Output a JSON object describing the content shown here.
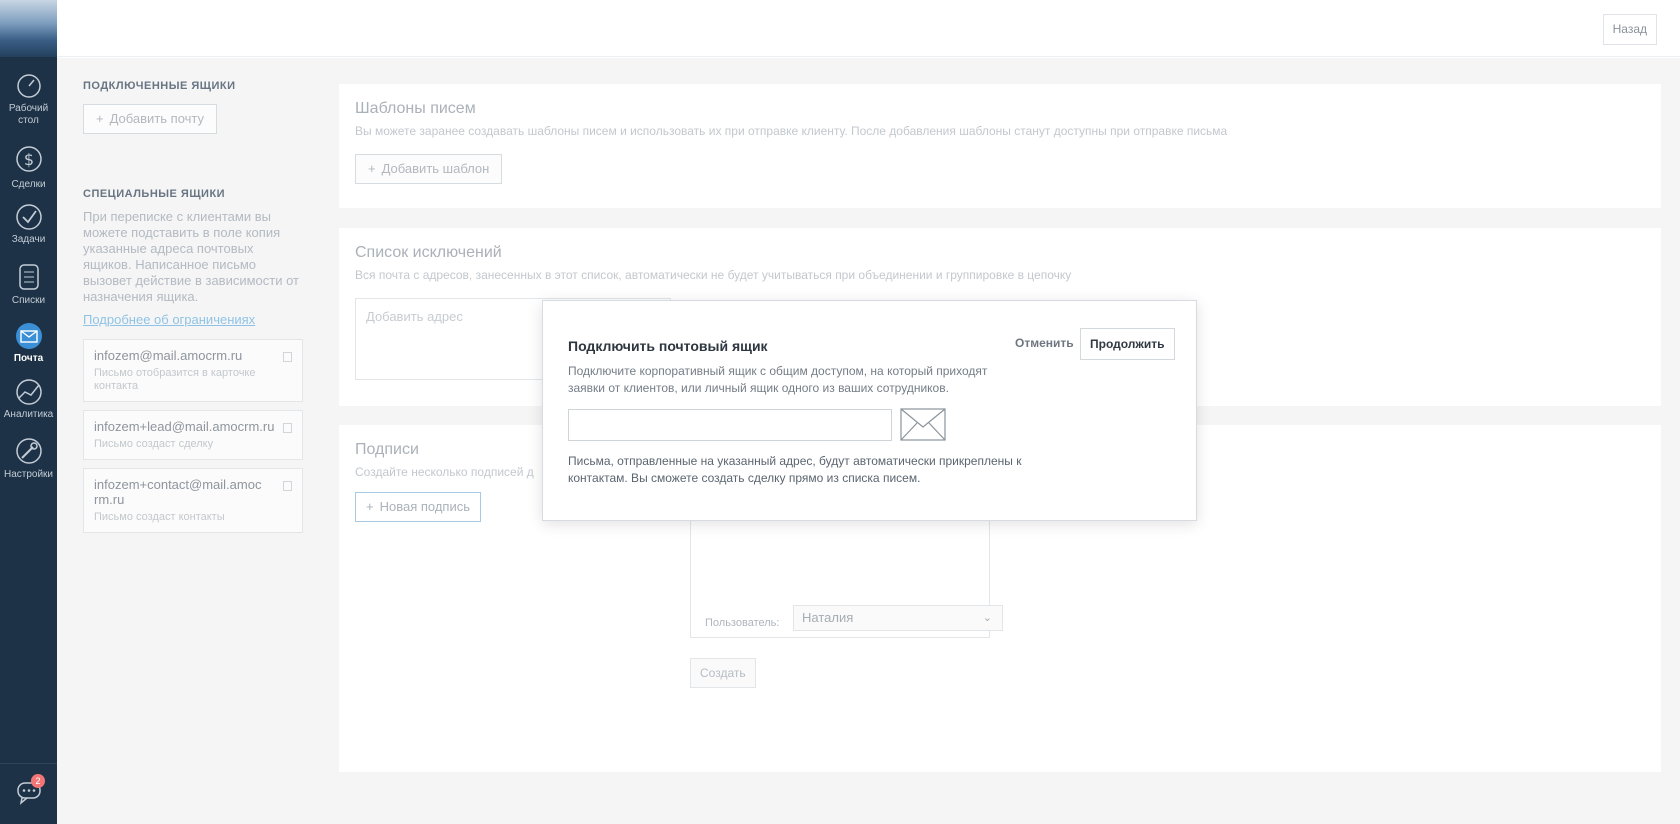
{
  "nav": {
    "items": [
      {
        "label": "Рабочий стол",
        "icon": "dashboard-icon"
      },
      {
        "label": "Сделки",
        "icon": "dollar-icon"
      },
      {
        "label": "Задачи",
        "icon": "checkmark-icon"
      },
      {
        "label": "Списки",
        "icon": "list-icon"
      },
      {
        "label": "Почта",
        "icon": "mail-icon",
        "active": true
      },
      {
        "label": "Аналитика",
        "icon": "analytics-icon"
      },
      {
        "label": "Настройки",
        "icon": "settings-icon"
      }
    ],
    "chat_badge": "2"
  },
  "header": {
    "back_label": "Назад"
  },
  "left": {
    "connected_title": "ПОДКЛЮЧЕННЫЕ ЯЩИКИ",
    "add_mail_label": "Добавить почту",
    "special_title": "СПЕЦИАЛЬНЫЕ ЯЩИКИ",
    "special_desc": "При переписке с клиентами вы можете подставить в поле копия указанные адреса почтовых ящиков. Написанное письмо вызовет действие в зависимости от назначения ящика.",
    "limits_link": "Подробнее об ограничениях",
    "mailboxes": [
      {
        "address": "infozem@mail.amocrm.ru",
        "note": "Письмо отобразится в карточке контакта"
      },
      {
        "address": "infozem+lead@mail.amocrm.ru",
        "note": "Письмо создаст сделку"
      },
      {
        "address": "infozem+contact@mail.amocrm.ru",
        "note": "Письмо создаст контакты"
      }
    ]
  },
  "templates": {
    "title": "Шаблоны писем",
    "desc": "Вы можете заранее создавать шаблоны писем и использовать их при отправке клиенту. После добавления шаблоны станут доступны при отправке письма",
    "add_label": "Добавить шаблон"
  },
  "exclusions": {
    "title": "Список исключений",
    "desc": "Вся почта с адресов, занесенных в этот список, автоматически не будет учитываться при объединении и группировке в цепочку",
    "placeholder": "Добавить адрес"
  },
  "signatures": {
    "title": "Подписи",
    "desc": "Создайте несколько подписей д",
    "new_label": "Новая подпись",
    "user_label": "Пользователь:",
    "user_value": "Наталия",
    "create_label": "Создать"
  },
  "modal": {
    "title": "Подключить почтовый ящик",
    "description": "Подключите корпоративный ящик с общим доступом, на который приходят заявки от клиентов, или личный ящик одного из ваших сотрудников.",
    "note": "Письма, отправленные на указанный адрес, будут автоматически прикреплены к контактам. Вы сможете создать сделку прямо из списка писем.",
    "cancel_label": "Отменить",
    "continue_label": "Продолжить"
  }
}
